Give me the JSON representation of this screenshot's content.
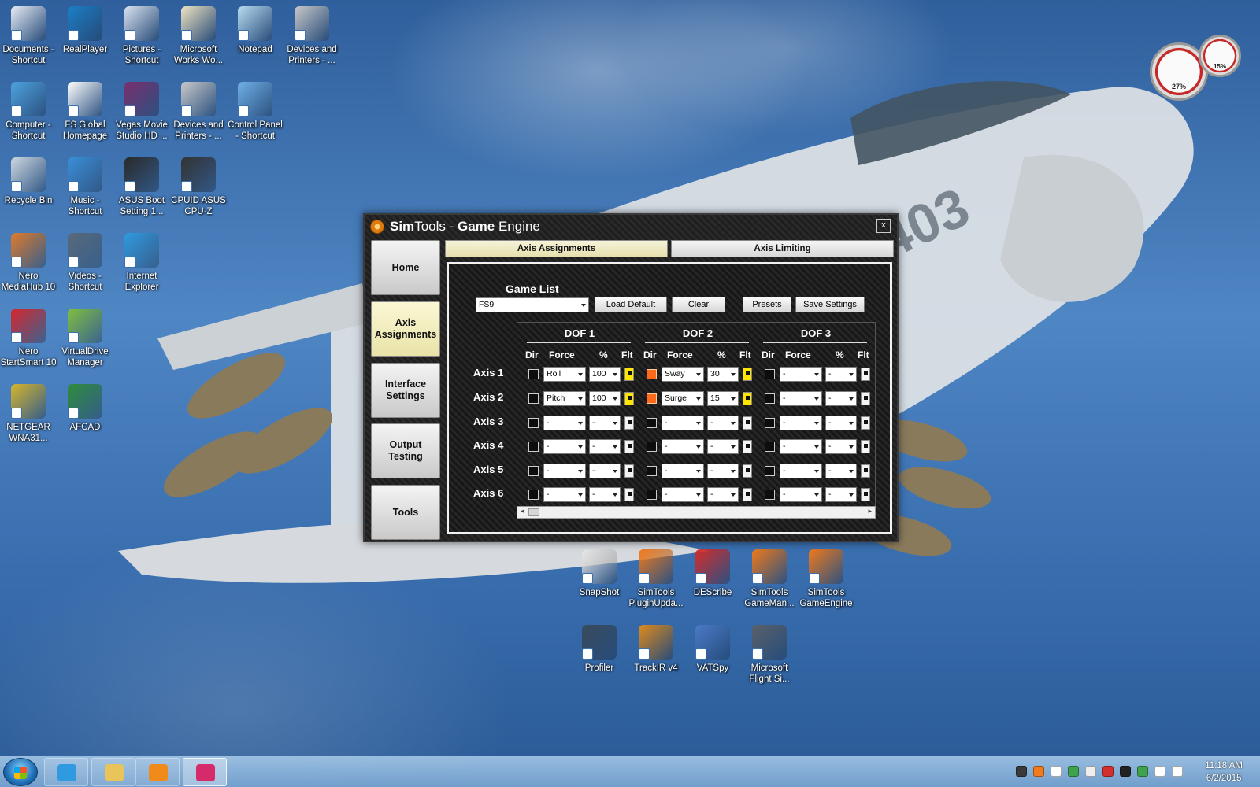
{
  "desktop": {
    "icons": [
      {
        "label": "Documents - Shortcut",
        "icon": "documents-icon",
        "color": "#e8edf5"
      },
      {
        "label": "RealPlayer",
        "icon": "realplayer-icon",
        "color": "#1b7fc7"
      },
      {
        "label": "Pictures - Shortcut",
        "icon": "pictures-icon",
        "color": "#d9e2ef"
      },
      {
        "label": "Microsoft Works Wo...",
        "icon": "works-icon",
        "color": "#f0e4c2"
      },
      {
        "label": "Notepad",
        "icon": "notepad-icon",
        "color": "#b9dcf0"
      },
      {
        "label": "Devices and Printers - ...",
        "icon": "printer-icon",
        "color": "#c9c9c9"
      },
      {
        "label": "Computer - Shortcut",
        "icon": "computer-icon",
        "color": "#4da3e0"
      },
      {
        "label": "FS Global Homepage",
        "icon": "document-icon",
        "color": "#ffffff"
      },
      {
        "label": "Vegas Movie Studio HD ...",
        "icon": "vegas-icon",
        "color": "#7a2f6f"
      },
      {
        "label": "Devices and Printers - ...",
        "icon": "printer-icon",
        "color": "#c9c9c9"
      },
      {
        "label": "Control Panel - Shortcut",
        "icon": "control-panel-icon",
        "color": "#6fb0e6"
      },
      {
        "label": "Recycle Bin",
        "icon": "recycle-bin-icon",
        "color": "#cfd8e0"
      },
      {
        "label": "Music - Shortcut",
        "icon": "music-icon",
        "color": "#3a8fd9"
      },
      {
        "label": "ASUS Boot Setting 1...",
        "icon": "bios-icon",
        "color": "#2a2a2a"
      },
      {
        "label": "CPUID ASUS CPU-Z",
        "icon": "cpu-icon",
        "color": "#333333"
      },
      {
        "label": "Nero MediaHub 10",
        "icon": "nero-mediahub-icon",
        "color": "#e07b2a"
      },
      {
        "label": "Videos - Shortcut",
        "icon": "videos-icon",
        "color": "#5a6a7a"
      },
      {
        "label": "Internet Explorer",
        "icon": "ie-icon",
        "color": "#2f9ae0"
      },
      {
        "label": "Nero StartSmart 10",
        "icon": "nero-startsmart-icon",
        "color": "#d8262b"
      },
      {
        "label": "VirtualDrive Manager",
        "icon": "virtualdrive-icon",
        "color": "#7fbf3f"
      },
      {
        "label": "NETGEAR WNA31...",
        "icon": "netgear-icon",
        "color": "#d7b52a"
      },
      {
        "label": "AFCAD",
        "icon": "afcad-icon",
        "color": "#2e8b3a"
      },
      {
        "label": "SnapShot",
        "icon": "snapshot-icon",
        "color": "#e8e8e8"
      },
      {
        "label": "SimTools PluginUpda...",
        "icon": "simtools-icon",
        "color": "#f07a1c"
      },
      {
        "label": "DEScribe",
        "icon": "describe-icon",
        "color": "#d62b2b"
      },
      {
        "label": "SimTools GameMan...",
        "icon": "simtools-icon",
        "color": "#f07a1c"
      },
      {
        "label": "SimTools GameEngine",
        "icon": "simtools-icon",
        "color": "#f07a1c"
      },
      {
        "label": "Profiler",
        "icon": "joystick-icon",
        "color": "#3a4a5a"
      },
      {
        "label": "TrackIR v4",
        "icon": "trackir-icon",
        "color": "#e08a1a"
      },
      {
        "label": "VATSpy",
        "icon": "vatspy-icon",
        "color": "#4a7ac8"
      },
      {
        "label": "Microsoft Flight Si...",
        "icon": "airplane-icon",
        "color": "#5a6068"
      }
    ],
    "gadget": {
      "cpu_percent": "27%",
      "memory_percent": "15%"
    }
  },
  "window": {
    "title_part1": "Sim",
    "title_part2": "Tools - ",
    "title_part3": "Game",
    "title_part4": " Engine",
    "close_label": "x",
    "nav": [
      {
        "label": "Home",
        "active": false
      },
      {
        "label": "Axis Assignments",
        "active": true
      },
      {
        "label": "Interface Settings",
        "active": false
      },
      {
        "label": "Output Testing",
        "active": false
      },
      {
        "label": "Tools",
        "active": false
      }
    ],
    "tabs": [
      {
        "label": "Axis Assignments",
        "active": true
      },
      {
        "label": "Axis Limiting",
        "active": false
      }
    ],
    "game_list": {
      "label": "Game List",
      "selected": "FS9",
      "load_default": "Load Default",
      "clear": "Clear",
      "presets": "Presets",
      "save_settings": "Save Settings"
    },
    "dof_titles": [
      "DOF 1",
      "DOF 2",
      "DOF 3"
    ],
    "col_headers": {
      "dir": "Dir",
      "force": "Force",
      "pct": "%",
      "flt": "Flt"
    },
    "axes": [
      {
        "label": "Axis 1",
        "dofs": [
          {
            "dir": false,
            "force": "Roll",
            "pct": "100",
            "flt": true
          },
          {
            "dir": true,
            "force": "Sway",
            "pct": "30",
            "flt": true
          },
          {
            "dir": false,
            "force": "-",
            "pct": "-",
            "flt": false
          }
        ]
      },
      {
        "label": "Axis 2",
        "dofs": [
          {
            "dir": false,
            "force": "Pitch",
            "pct": "100",
            "flt": true
          },
          {
            "dir": true,
            "force": "Surge",
            "pct": "15",
            "flt": true
          },
          {
            "dir": false,
            "force": "-",
            "pct": "-",
            "flt": false
          }
        ]
      },
      {
        "label": "Axis 3",
        "dofs": [
          {
            "dir": false,
            "force": "-",
            "pct": "-",
            "flt": false
          },
          {
            "dir": false,
            "force": "-",
            "pct": "-",
            "flt": false
          },
          {
            "dir": false,
            "force": "-",
            "pct": "-",
            "flt": false
          }
        ]
      },
      {
        "label": "Axis 4",
        "dofs": [
          {
            "dir": false,
            "force": "-",
            "pct": "-",
            "flt": false
          },
          {
            "dir": false,
            "force": "-",
            "pct": "-",
            "flt": false
          },
          {
            "dir": false,
            "force": "-",
            "pct": "-",
            "flt": false
          }
        ]
      },
      {
        "label": "Axis 5",
        "dofs": [
          {
            "dir": false,
            "force": "-",
            "pct": "-",
            "flt": false
          },
          {
            "dir": false,
            "force": "-",
            "pct": "-",
            "flt": false
          },
          {
            "dir": false,
            "force": "-",
            "pct": "-",
            "flt": false
          }
        ]
      },
      {
        "label": "Axis 6",
        "dofs": [
          {
            "dir": false,
            "force": "-",
            "pct": "-",
            "flt": false
          },
          {
            "dir": false,
            "force": "-",
            "pct": "-",
            "flt": false
          },
          {
            "dir": false,
            "force": "-",
            "pct": "-",
            "flt": false
          }
        ]
      }
    ]
  },
  "taskbar": {
    "items": [
      {
        "icon": "internet-explorer-icon",
        "color": "#2f9ae0",
        "state": "pinned"
      },
      {
        "icon": "folder-icon",
        "color": "#e8c45a",
        "state": "pinned"
      },
      {
        "icon": "media-player-icon",
        "color": "#f08a1a",
        "state": "pinned"
      },
      {
        "icon": "snapshot-icon",
        "color": "#d62b6a",
        "state": "running"
      }
    ],
    "tray": [
      {
        "icon": "network-gadget-icon",
        "color": "#3a3a3a"
      },
      {
        "icon": "simtools-tray-icon",
        "color": "#f07a1c"
      },
      {
        "icon": "windows-tray-icon",
        "color": "#ffffff"
      },
      {
        "icon": "sync-tray-icon",
        "color": "#3fa34d"
      },
      {
        "icon": "device-tray-icon",
        "color": "#eeeeee"
      },
      {
        "icon": "flag-tray-icon",
        "color": "#d32f2f"
      },
      {
        "icon": "antivirus-tray-icon",
        "color": "#222222"
      },
      {
        "icon": "arrow-tray-icon",
        "color": "#3fa34d"
      },
      {
        "icon": "signal-tray-icon",
        "color": "#ffffff"
      },
      {
        "icon": "volume-icon",
        "color": "#ffffff"
      }
    ],
    "time": "11:18 AM",
    "date": "6/2/2015"
  }
}
